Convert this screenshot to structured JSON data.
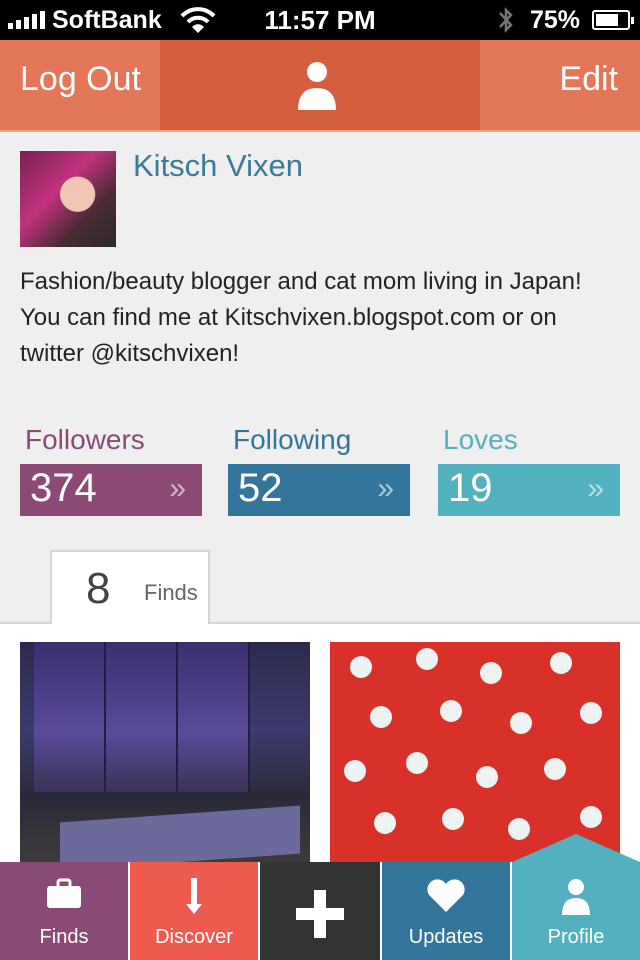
{
  "status_bar": {
    "carrier": "SoftBank",
    "time": "11:57 PM",
    "battery": "75%",
    "icons": [
      "signal-icon",
      "wifi-icon",
      "bluetooth-icon",
      "battery-icon"
    ]
  },
  "nav": {
    "left_label": "Log Out",
    "right_label": "Edit",
    "center_icon": "person-icon",
    "colors": {
      "bar": "#e47658",
      "center": "#d35f3f"
    }
  },
  "profile": {
    "name": "Kitsch Vixen",
    "bio": "Fashion/beauty blogger and cat mom living in Japan! You can find me at Kitschvixen.blogspot.com or on twitter @kitschvixen!"
  },
  "stats": [
    {
      "label": "Followers",
      "value": "374",
      "color": "#8b4a76"
    },
    {
      "label": "Following",
      "value": "52",
      "color": "#33759b"
    },
    {
      "label": "Loves",
      "value": "19",
      "color": "#53b0be"
    }
  ],
  "chevron": "»",
  "tab": {
    "count": "8",
    "label": "Finds"
  },
  "tab_bar": {
    "items": [
      {
        "label": "Finds",
        "icon": "briefcase-icon",
        "color": "#8a4a77"
      },
      {
        "label": "Discover",
        "icon": "thermometer-icon",
        "color": "#ef5a4f"
      },
      {
        "label": "",
        "icon": "plus-icon",
        "color": "#333333"
      },
      {
        "label": "Updates",
        "icon": "heart-icon",
        "color": "#33759b"
      },
      {
        "label": "Profile",
        "icon": "person-icon",
        "color": "#53b0be"
      }
    ]
  }
}
